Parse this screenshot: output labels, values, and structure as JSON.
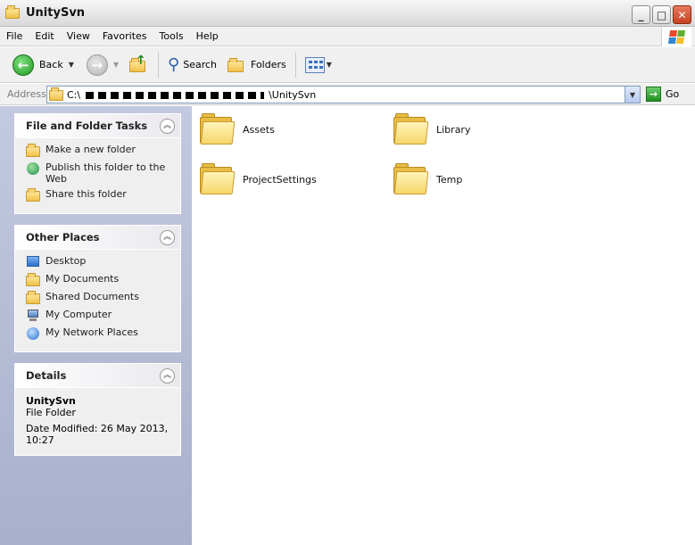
{
  "window": {
    "title": "UnitySvn"
  },
  "menu": [
    {
      "label": "File"
    },
    {
      "label": "Edit"
    },
    {
      "label": "View"
    },
    {
      "label": "Favorites"
    },
    {
      "label": "Tools"
    },
    {
      "label": "Help"
    }
  ],
  "toolbar": {
    "back_label": "Back",
    "search_label": "Search",
    "folders_label": "Folders"
  },
  "address": {
    "label": "Address",
    "path_prefix": "C:\\",
    "path_suffix": "\\UnitySvn",
    "go_label": "Go"
  },
  "tasks_panel": {
    "title": "File and Folder Tasks",
    "items": [
      {
        "label": "Make a new folder",
        "icon": "new-folder-icon"
      },
      {
        "label": "Publish this folder to the Web",
        "icon": "publish-web-icon"
      },
      {
        "label": "Share this folder",
        "icon": "share-folder-icon"
      }
    ]
  },
  "places_panel": {
    "title": "Other Places",
    "items": [
      {
        "label": "Desktop",
        "icon": "desktop-icon"
      },
      {
        "label": "My Documents",
        "icon": "my-documents-icon"
      },
      {
        "label": "Shared Documents",
        "icon": "shared-documents-icon"
      },
      {
        "label": "My Computer",
        "icon": "my-computer-icon"
      },
      {
        "label": "My Network Places",
        "icon": "network-places-icon"
      }
    ]
  },
  "details_panel": {
    "title": "Details",
    "name": "UnitySvn",
    "type": "File Folder",
    "modified": "Date Modified: 26 May 2013, 10:27"
  },
  "folders": [
    {
      "name": "Assets"
    },
    {
      "name": "Library"
    },
    {
      "name": "ProjectSettings"
    },
    {
      "name": "Temp"
    }
  ],
  "colors": {
    "pane_gradient_top": "#c2c9e0",
    "pane_gradient_bottom": "#a8b0cc",
    "folder_yellow": "#f7d66b"
  }
}
